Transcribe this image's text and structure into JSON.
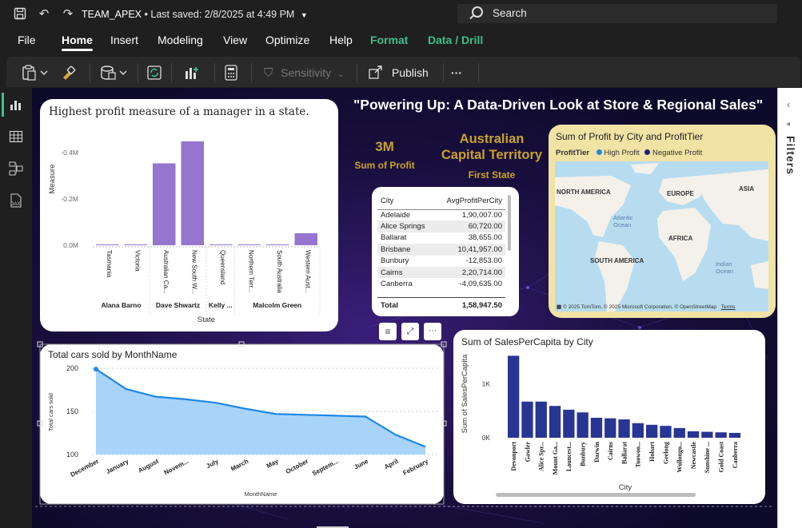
{
  "titlebar": {
    "doc_name": "TEAM_APEX",
    "saved": "• Last saved: 2/8/2025 at 4:49 PM",
    "search_placeholder": "Search"
  },
  "menu": [
    "File",
    "Home",
    "Insert",
    "Modeling",
    "View",
    "Optimize",
    "Help",
    "Format",
    "Data / Drill"
  ],
  "ribbon": {
    "sensitivity": "Sensitivity",
    "publish": "Publish",
    "more": "···"
  },
  "filters_label": "Filters",
  "report": {
    "title": "\"Powering Up: A Data-Driven Look at Store & Regional Sales\"",
    "kpi_profit": {
      "value": "3M",
      "label": "Sum of Profit"
    },
    "kpi_state": {
      "value_line1": "Australian",
      "value_line2": "Capital Territory",
      "label": "First State"
    }
  },
  "manager_chart": {
    "title": "Highest profit measure of a manager in a state.",
    "ylabel": "Measure",
    "xlabel": "State",
    "yticks": [
      "-0.4M",
      "-0.2M",
      "0.0M"
    ],
    "bars": [
      {
        "state": "Tasmania",
        "value": 0.002
      },
      {
        "state": "Victoria",
        "value": 0.002
      },
      {
        "state": "Australian Ca...",
        "value": 0.41
      },
      {
        "state": "New South W...",
        "value": 0.52
      },
      {
        "state": "Queensland",
        "value": 0.002
      },
      {
        "state": "Northern Terr...",
        "value": 0.002
      },
      {
        "state": "South Australia",
        "value": 0.002
      },
      {
        "state": "Western Aust...",
        "value": 0.06
      }
    ],
    "managers": [
      "Alana Barno",
      "Dave Shwartz",
      "Kelly ...",
      "Malcolm Green"
    ],
    "color": "#9575cd"
  },
  "city_table": {
    "headers": [
      "City",
      "AvgProfitPerCity"
    ],
    "rows": [
      [
        "Adelaide",
        "1,90,007.00"
      ],
      [
        "Alice Springs",
        "60,720.00"
      ],
      [
        "Ballarat",
        "38,655.00"
      ],
      [
        "Brisbane",
        "10,41,957.00"
      ],
      [
        "Bunbury",
        "-12,853.00"
      ],
      [
        "Cairns",
        "2,20,714.00"
      ],
      [
        "Canberra",
        "-4,09,635.00"
      ]
    ],
    "total_label": "Total",
    "total_value": "1,58,947.50"
  },
  "map": {
    "title": "Sum of Profit by City and ProfitTier",
    "legend_title": "ProfitTier",
    "legend": [
      {
        "name": "High Profit",
        "color": "#1e88e5"
      },
      {
        "name": "Negative Profit",
        "color": "#1a237e"
      }
    ],
    "labels": [
      "NORTH AMERICA",
      "EUROPE",
      "ASIA",
      "Atlantic Ocean",
      "AFRICA",
      "SOUTH AMERICA",
      "Indian Ocean"
    ],
    "credit": "© 2025 TomTom, © 2025 Microsoft Corporation, © OpenStreetMap",
    "terms": "Terms",
    "bg": "#f1e3a4"
  },
  "cars_chart": {
    "title": "Total cars sold by MonthName",
    "ylabel": "Total cars sold",
    "xlabel": "MonthName",
    "months": [
      "December",
      "January",
      "August",
      "Novem...",
      "July",
      "March",
      "May",
      "October",
      "Septem...",
      "June",
      "April",
      "February"
    ],
    "values": [
      199,
      176,
      167,
      164,
      160,
      153,
      147,
      146,
      145,
      144,
      123,
      109
    ],
    "yticks": [
      200,
      150,
      100
    ],
    "ylim": [
      100,
      200
    ],
    "color": "#1e88e5"
  },
  "sales_chart": {
    "title": "Sum of SalesPerCapita by City",
    "ylabel": "Sum of SalesPerCapita",
    "xlabel": "City",
    "yticks": [
      "1K",
      "0K"
    ],
    "cities": [
      "Devonport",
      "Gawler",
      "Alice Spr...",
      "Mount Ga...",
      "Launcest...",
      "Bunbury",
      "Darwin",
      "Cairns",
      "Ballarat",
      "Toowoo...",
      "Hobart",
      "Geelong",
      "Wollongo...",
      "Newcastle",
      "Sunshine ...",
      "Gold Coast",
      "Canberra"
    ],
    "values": [
      1520,
      670,
      670,
      590,
      520,
      470,
      370,
      360,
      340,
      270,
      240,
      220,
      180,
      120,
      110,
      100,
      90
    ],
    "ymax": 1600,
    "color": "#283593"
  }
}
